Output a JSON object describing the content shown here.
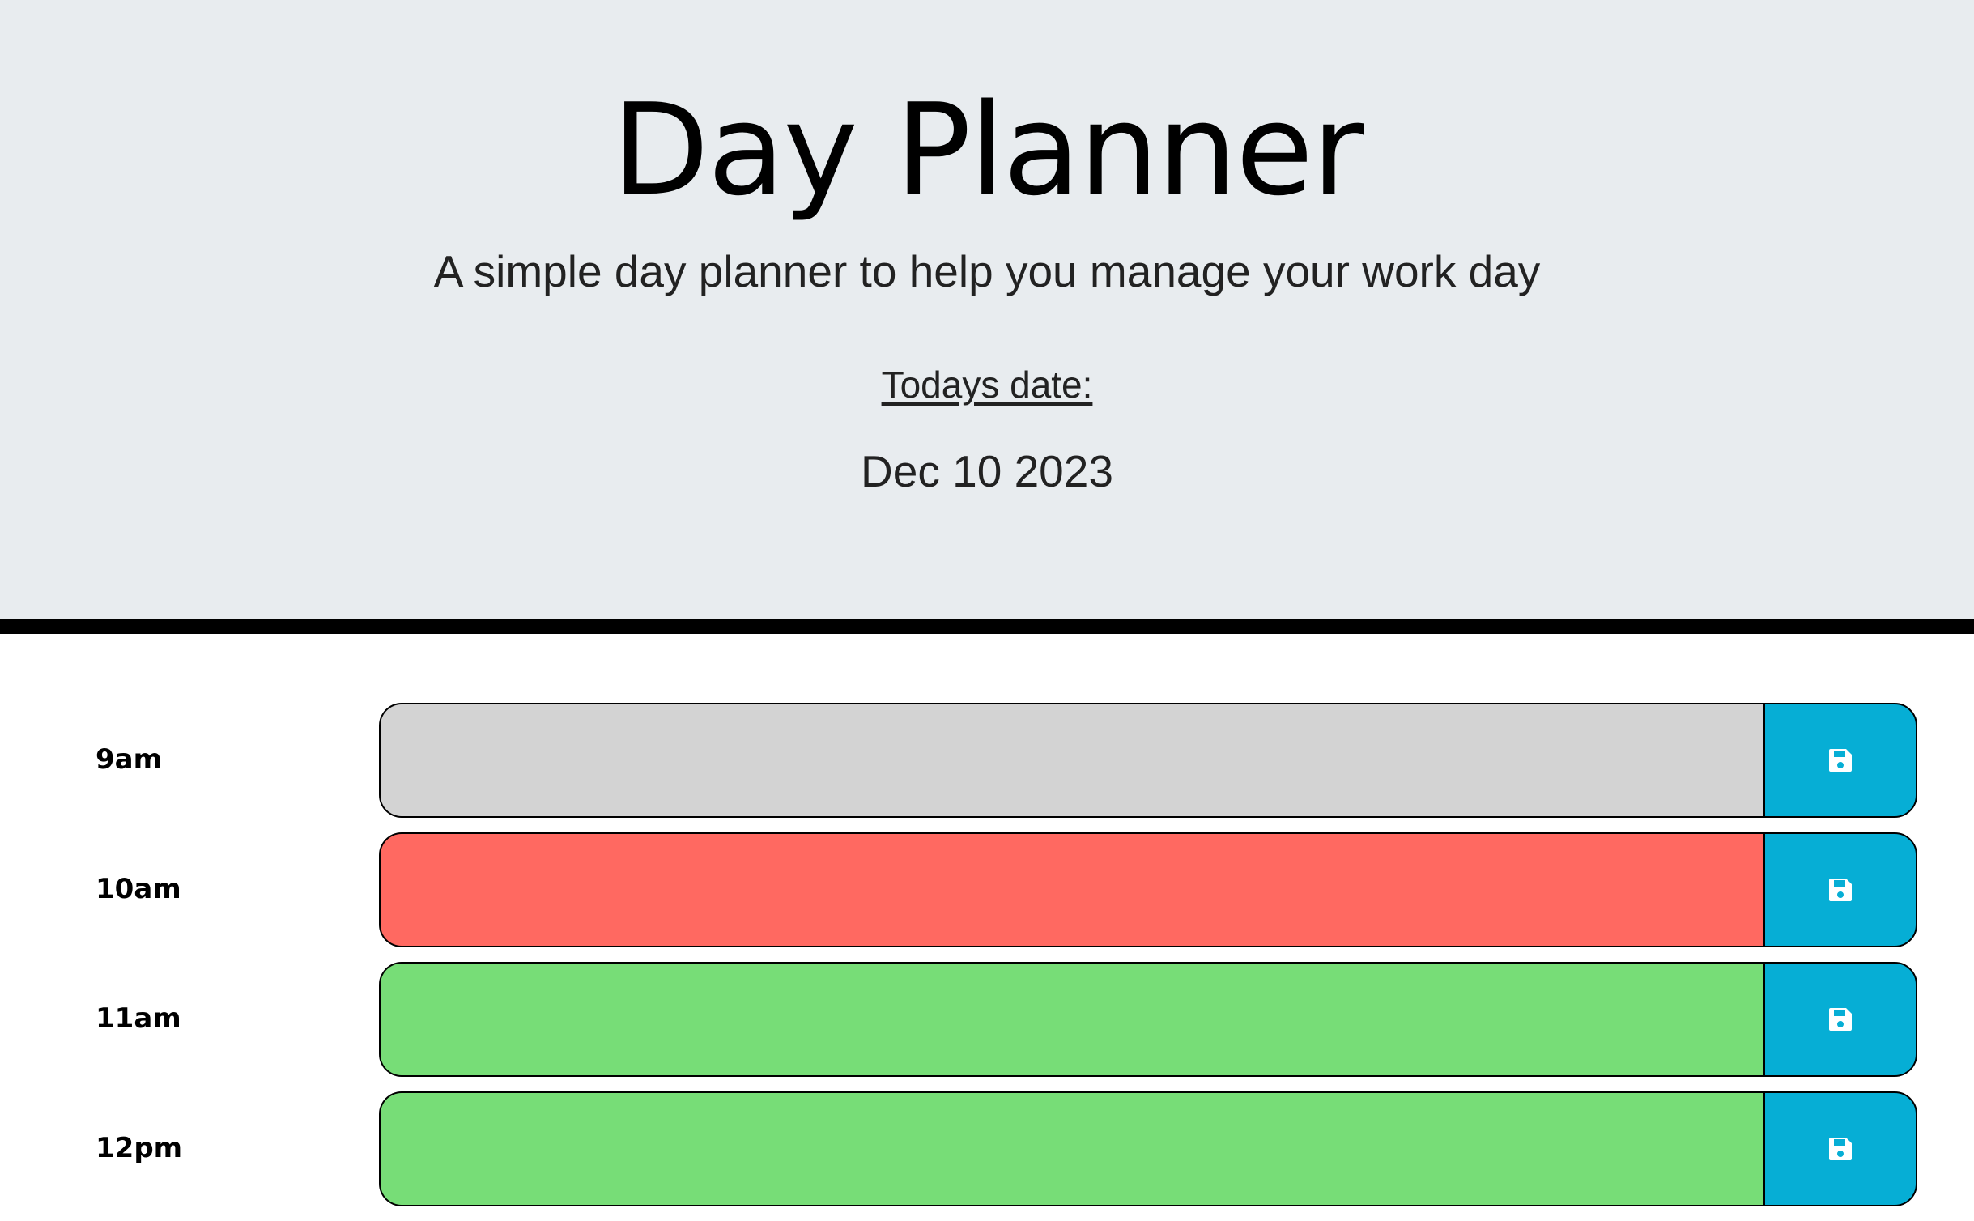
{
  "header": {
    "title": "Day Planner",
    "subtitle": "A simple day planner to help you manage your work day",
    "date_label": "Todays date:",
    "date_value": "Dec 10 2023"
  },
  "rows": [
    {
      "hour": "9am",
      "text": "",
      "state": "past",
      "color": "#d3d3d3",
      "save_icon": "floppy-disk-icon"
    },
    {
      "hour": "10am",
      "text": "",
      "state": "present",
      "color": "#ff6961",
      "save_icon": "floppy-disk-icon"
    },
    {
      "hour": "11am",
      "text": "",
      "state": "future",
      "color": "#77dd77",
      "save_icon": "floppy-disk-icon"
    },
    {
      "hour": "12pm",
      "text": "",
      "state": "future",
      "color": "#77dd77",
      "save_icon": "floppy-disk-icon"
    }
  ],
  "colors": {
    "header_bg": "#e8ecef",
    "save_button": "#06aed5"
  }
}
